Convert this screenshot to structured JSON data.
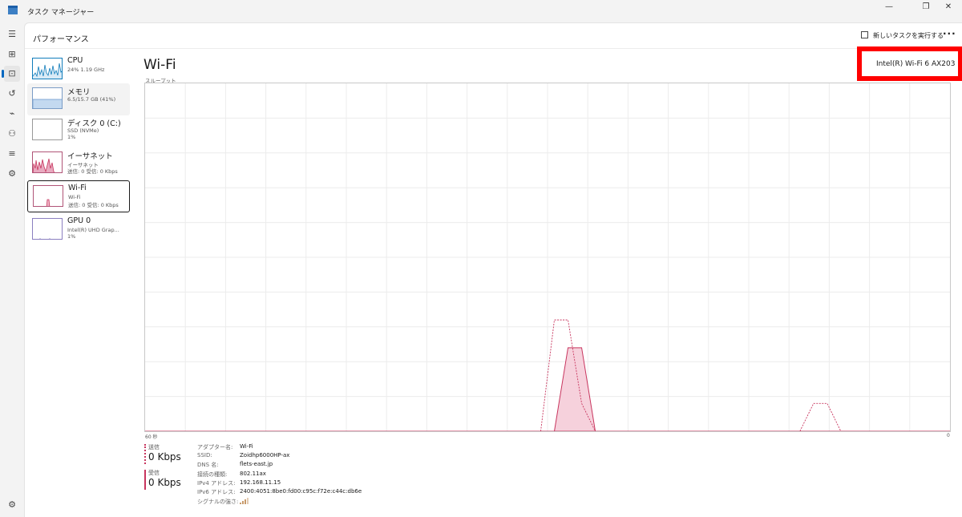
{
  "window": {
    "title": "タスク マネージャー",
    "controls": {
      "minimize": "—",
      "restore": "❐",
      "close": "✕"
    }
  },
  "nav": {
    "items": [
      {
        "icon": "hamburger-icon",
        "glyph": "☰"
      },
      {
        "icon": "processes-icon",
        "glyph": "⊞"
      },
      {
        "icon": "performance-icon",
        "glyph": "⊡",
        "active": true
      },
      {
        "icon": "app-history-icon",
        "glyph": "↺"
      },
      {
        "icon": "startup-icon",
        "glyph": "⌁"
      },
      {
        "icon": "users-icon",
        "glyph": "⚇"
      },
      {
        "icon": "details-icon",
        "glyph": "≡"
      },
      {
        "icon": "services-icon",
        "glyph": "⚙"
      }
    ],
    "settings_glyph": "⚙"
  },
  "header": {
    "section_title": "パフォーマンス",
    "run_task_label": "新しいタスクを実行する",
    "more_label": "···"
  },
  "devices": [
    {
      "name": "CPU",
      "sub1": "24%  1.19 GHz",
      "sub2": "",
      "sub3": "",
      "color": "#117dbb"
    },
    {
      "name": "メモリ",
      "sub1": "6.5/15.7 GB (41%)",
      "sub2": "",
      "sub3": "",
      "color": "#8b12ae",
      "fill": 0.41
    },
    {
      "name": "ディスク 0 (C:)",
      "sub1": "SSD (NVMe)",
      "sub2": "1%",
      "sub3": "",
      "color": "#4da60c"
    },
    {
      "name": "イーサネット",
      "sub1": "イーサネット",
      "sub2": "送信: 0 受信: 0 Kbps",
      "sub3": "",
      "color": "#a74f01"
    },
    {
      "name": "Wi-Fi",
      "sub1": "Wi-Fi",
      "sub2": "送信: 0 受信: 0 Kbps",
      "sub3": "",
      "color": "#a74f01",
      "selected": true
    },
    {
      "name": "GPU 0",
      "sub1": "Intel(R) UHD Grap...",
      "sub2": "1%",
      "sub3": "",
      "color": "#ac3975"
    }
  ],
  "main": {
    "title": "Wi-Fi",
    "adapter_name": "Intel(R) Wi-Fi 6 AX203",
    "graph_label": "スループット",
    "axis_left": "60 秒",
    "axis_right": "0",
    "graph_color": "#c8355e",
    "graph_fill": "#f6d1dc"
  },
  "chart_data": {
    "type": "area",
    "x_range": [
      60,
      0
    ],
    "series": [
      {
        "name": "受信",
        "style": "solid-fill",
        "values": [
          0,
          0,
          0,
          0,
          0,
          0,
          0,
          0,
          0,
          0,
          0,
          0,
          0,
          0,
          0,
          0,
          0,
          0,
          0,
          0,
          0,
          0,
          0,
          0,
          0,
          0,
          0,
          0,
          0,
          0,
          0,
          0.24,
          0.24,
          0,
          0,
          0,
          0,
          0,
          0,
          0,
          0,
          0,
          0,
          0,
          0,
          0,
          0,
          0,
          0,
          0,
          0,
          0,
          0,
          0,
          0,
          0,
          0,
          0,
          0,
          0
        ]
      },
      {
        "name": "送信",
        "style": "dashed",
        "values": [
          0,
          0,
          0,
          0,
          0,
          0,
          0,
          0,
          0,
          0,
          0,
          0,
          0,
          0,
          0,
          0,
          0,
          0,
          0,
          0,
          0,
          0,
          0,
          0,
          0,
          0,
          0,
          0,
          0,
          0,
          0.32,
          0.32,
          0.08,
          0,
          0,
          0,
          0,
          0,
          0,
          0,
          0,
          0,
          0,
          0,
          0,
          0,
          0,
          0,
          0,
          0.08,
          0.08,
          0,
          0,
          0,
          0,
          0,
          0,
          0,
          0,
          0
        ]
      }
    ]
  },
  "stats": {
    "send_label": "送信",
    "send_value": "0 Kbps",
    "recv_label": "受信",
    "recv_value": "0 Kbps"
  },
  "properties": [
    {
      "key": "アダプター名:",
      "value": "Wi-Fi"
    },
    {
      "key": "SSID:",
      "value": "Zoidhp6000HP-ax"
    },
    {
      "key": "DNS 名:",
      "value": "flets-east.jp"
    },
    {
      "key": "接続の種類:",
      "value": "802.11ax"
    },
    {
      "key": "IPv4 アドレス:",
      "value": "192.168.11.15"
    },
    {
      "key": "IPv6 アドレス:",
      "value": "2400:4051:8be0:fd00:c95c:f72e:c44c:db6e"
    },
    {
      "key": "シグナルの強さ:",
      "value": ""
    }
  ]
}
